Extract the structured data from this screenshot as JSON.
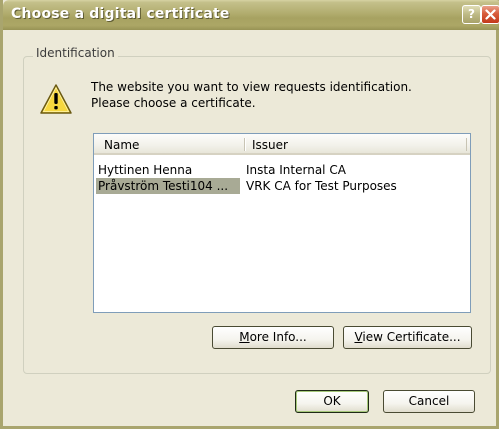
{
  "window": {
    "title": "Choose a digital certificate",
    "help_glyph": "?",
    "close_glyph": "X"
  },
  "group": {
    "legend": "Identification"
  },
  "message": {
    "line1": "The website you want to view requests identification.",
    "line2": "Please choose a certificate."
  },
  "icons": {
    "warning": "warning-icon",
    "help": "help-icon",
    "close": "close-icon"
  },
  "list": {
    "columns": [
      "Name",
      "Issuer"
    ],
    "rows": [
      {
        "name": "Hyttinen Henna",
        "issuer": "Insta Internal CA",
        "selected": false
      },
      {
        "name": "Pråvström Testi104 ...",
        "issuer": "VRK CA for Test Purposes",
        "selected": true
      }
    ]
  },
  "buttons": {
    "more_info": {
      "accel": "M",
      "rest": "ore Info..."
    },
    "view_certificate": {
      "accel": "V",
      "rest": "iew Certificate..."
    },
    "ok": "OK",
    "cancel": "Cancel"
  },
  "colors": {
    "titlebar": "#aca766",
    "selection": "#a8aa95",
    "face": "#ece9d8"
  }
}
